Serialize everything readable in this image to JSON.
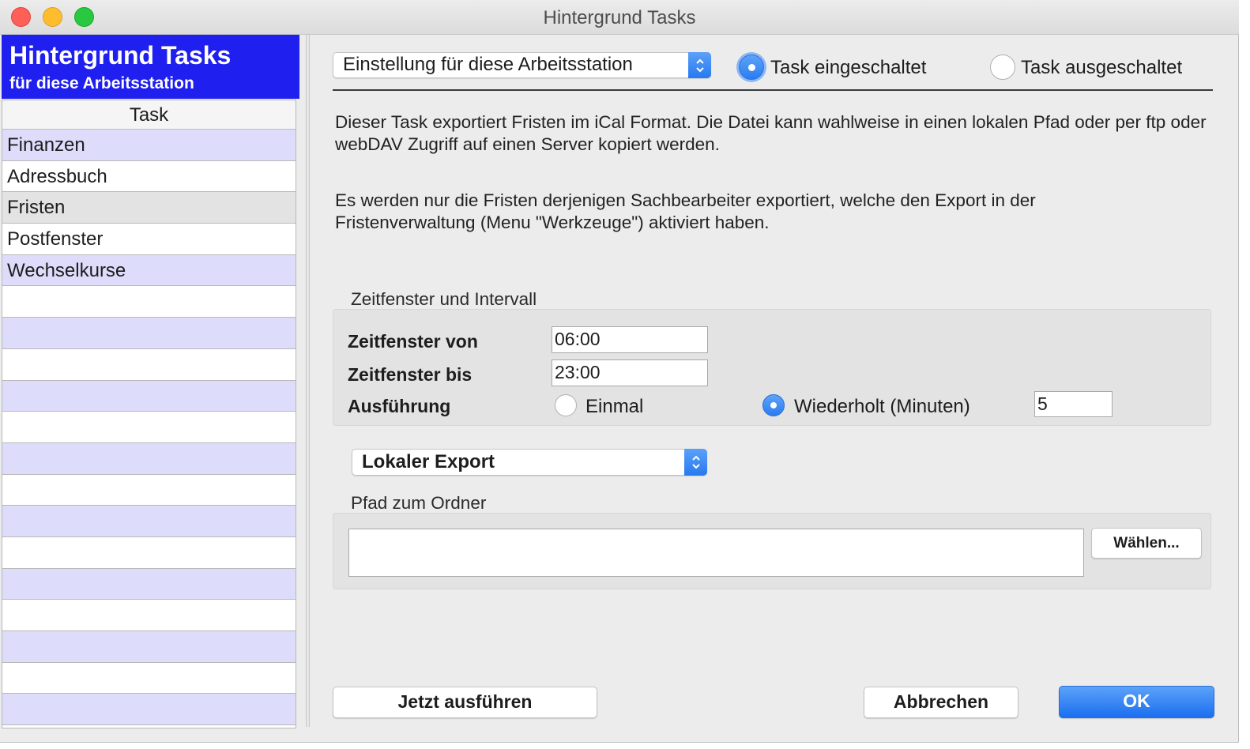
{
  "window": {
    "title": "Hintergrund Tasks"
  },
  "sidebar": {
    "title": "Hintergrund Tasks",
    "subtitle": "für diese Arbeitsstation",
    "column_header": "Task",
    "items": [
      "Finanzen",
      "Adressbuch",
      "Fristen",
      "Postfenster",
      "Wechselkurse",
      "",
      "",
      "",
      "",
      "",
      "",
      "",
      "",
      "",
      "",
      "",
      "",
      "",
      ""
    ],
    "selected": "Fristen"
  },
  "scope_select": {
    "value": "Einstellung für diese Arbeitsstation"
  },
  "task_state": {
    "on_label": "Task eingeschaltet",
    "off_label": "Task ausgeschaltet",
    "selected": "on"
  },
  "description": {
    "p1": "Dieser Task exportiert Fristen im iCal Format. Die Datei kann wahlweise in einen lokalen Pfad oder per ftp oder webDAV Zugriff auf einen Server kopiert werden.",
    "p2": "Es werden nur die Fristen derjenigen Sachbearbeiter exportiert, welche den Export in der Fristenverwaltung (Menu \"Werkzeuge\") aktiviert haben."
  },
  "timewindow": {
    "group_title": "Zeitfenster und Intervall",
    "from_label": "Zeitfenster von",
    "from_value": "06:00",
    "to_label": "Zeitfenster bis",
    "to_value": "23:00",
    "exec_label": "Ausführung",
    "once_label": "Einmal",
    "repeat_label": "Wiederholt (Minuten)",
    "repeat_selected": true,
    "interval_value": "5"
  },
  "export": {
    "type_value": "Lokaler Export",
    "path_group_title": "Pfad zum Ordner",
    "path_value": "",
    "choose_label": "Wählen..."
  },
  "footer": {
    "run_now_label": "Jetzt ausführen",
    "cancel_label": "Abbrechen",
    "ok_label": "OK"
  },
  "colors": {
    "sidebar_header": "#1f1ff0",
    "row_alt": "#dddcfb",
    "accent": "#2a7cf1"
  }
}
